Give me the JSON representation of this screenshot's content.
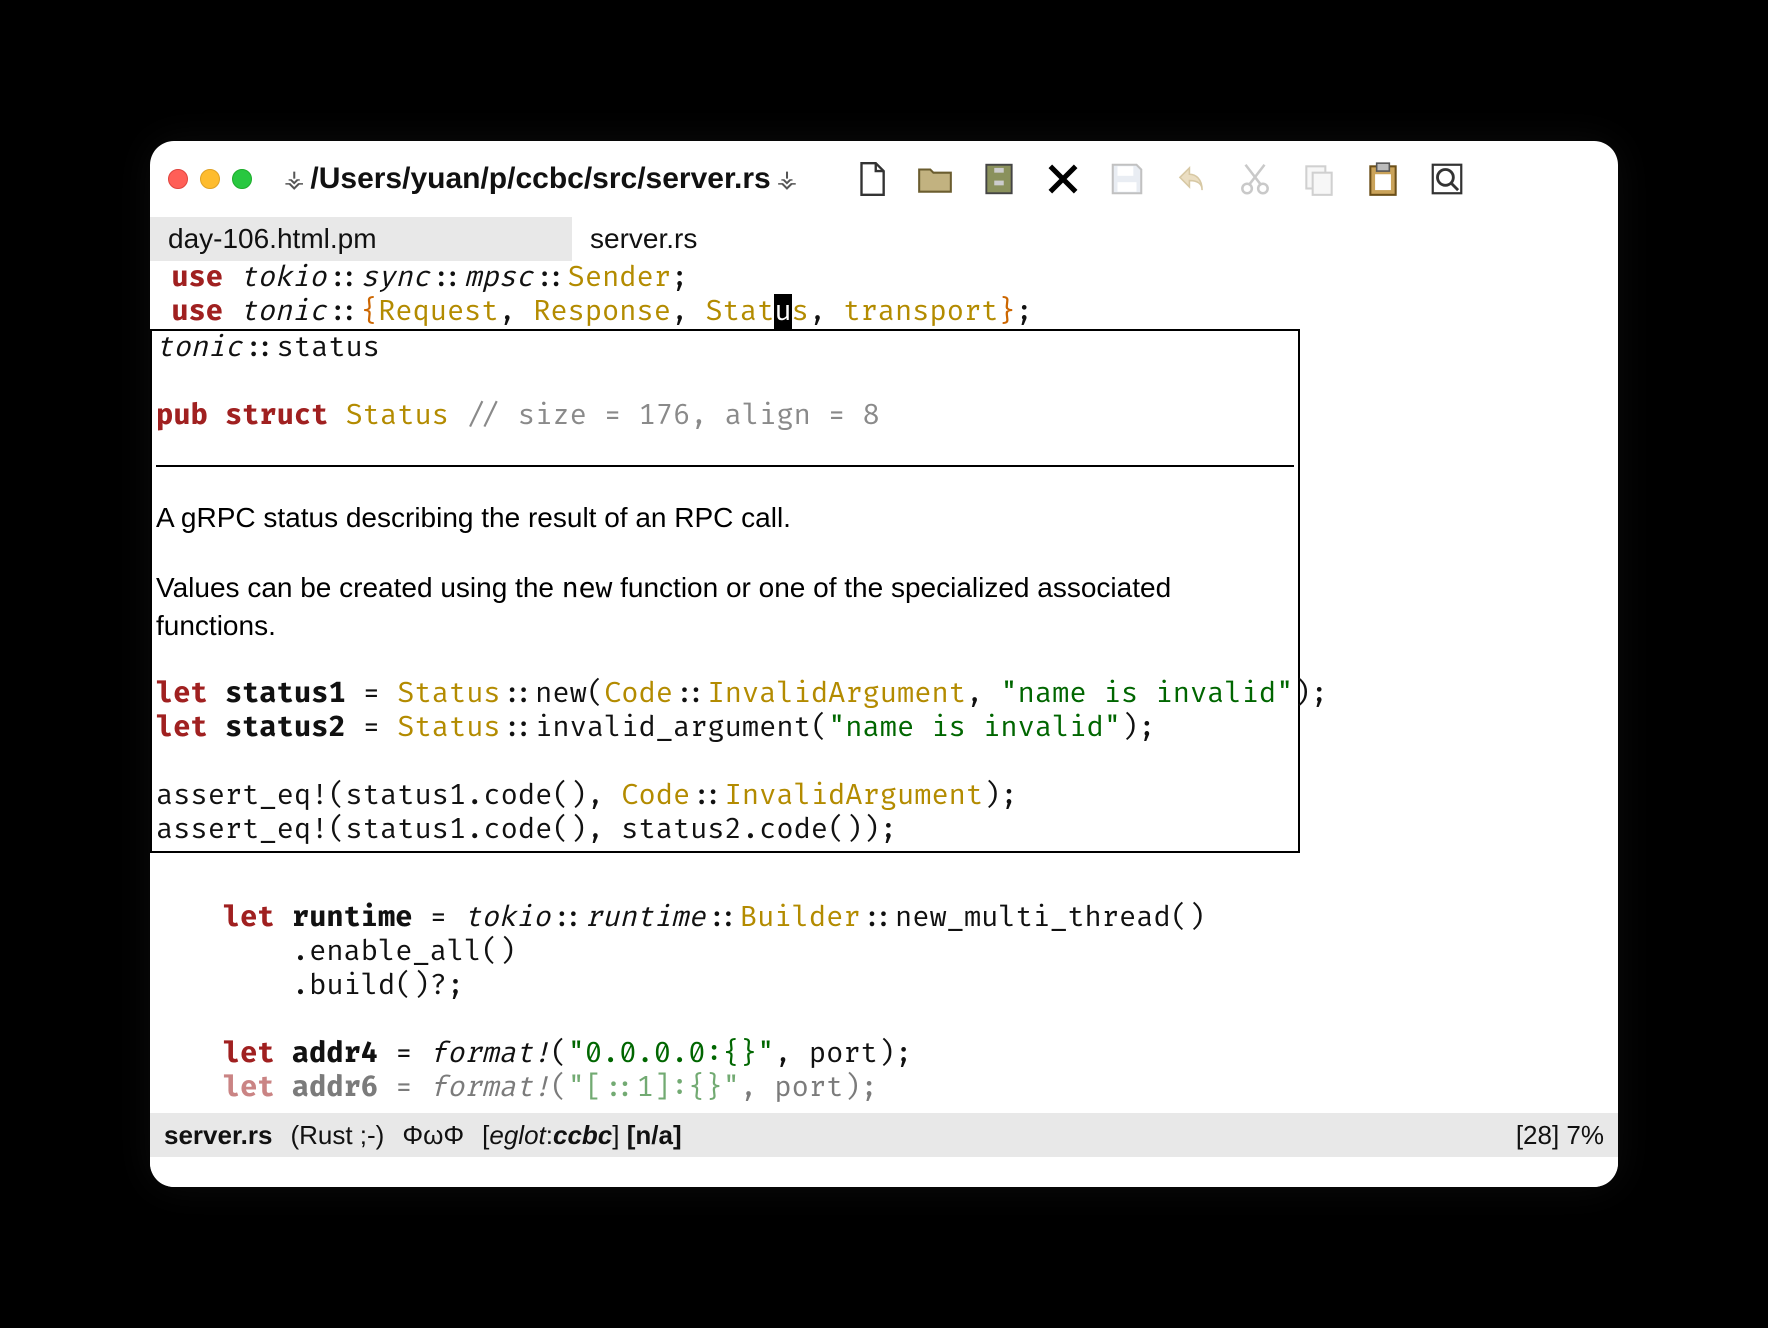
{
  "title_path": "/Users/yuan/p/ccbc/src/server.rs",
  "tabs": {
    "inactive": "day-106.html.pm",
    "active": "server.rs"
  },
  "code": {
    "l1": {
      "use": "use",
      "t1": "tokio",
      "t2": "sync",
      "t3": "mpsc",
      "sender": "Sender"
    },
    "l2": {
      "use": "use",
      "tonic": "tonic",
      "req": "Request",
      "resp": "Response",
      "stat_a": "Stat",
      "stat_u": "u",
      "stat_s": "s",
      "trans": "transport"
    }
  },
  "doc": {
    "header": {
      "tonic": "tonic",
      "sep": "::",
      "status": "status"
    },
    "decl": {
      "pub": "pub",
      "struct": "struct",
      "name": "Status",
      "size": "// size = 176, align = 8"
    },
    "p1": "A gRPC status describing the result of an RPC call.",
    "p2a": "Values can be created using the ",
    "p2_new": "new",
    "p2b": " function or one of the specialized associated functions.",
    "ex": {
      "let": "let",
      "s1": "status1",
      "s2": "status2",
      "Status": "Status",
      "new": "new",
      "Code": "Code",
      "IA": "InvalidArgument",
      "inv": "invalid_argument",
      "str": "\"name is invalid\"",
      "ae": "assert_eq!",
      "code": "code"
    }
  },
  "post": {
    "let": "let",
    "runtime": "runtime",
    "tokio": "tokio",
    "rtmod": "runtime",
    "builder": "Builder",
    "new_mt": "new_multi_thread",
    "enable_all": ".enable_all()",
    "build": ".build()?;",
    "addr4": "addr4",
    "format": "format!",
    "addr4_str": "\"0.0.0.0:{}\"",
    "port": "port",
    "addr6_partial": "addr6",
    "addr6_str": "\"[::1]:{}\""
  },
  "modeline": {
    "file": "server.rs",
    "mode": "(Rust ;-)",
    "phi": "ΦωΦ",
    "eglot_open": "[",
    "eglot": "eglot",
    "colon": ":",
    "ccbc": "ccbc",
    "eglot_close": "]",
    "na": "[n/a]",
    "pos": "[28] 7%"
  }
}
